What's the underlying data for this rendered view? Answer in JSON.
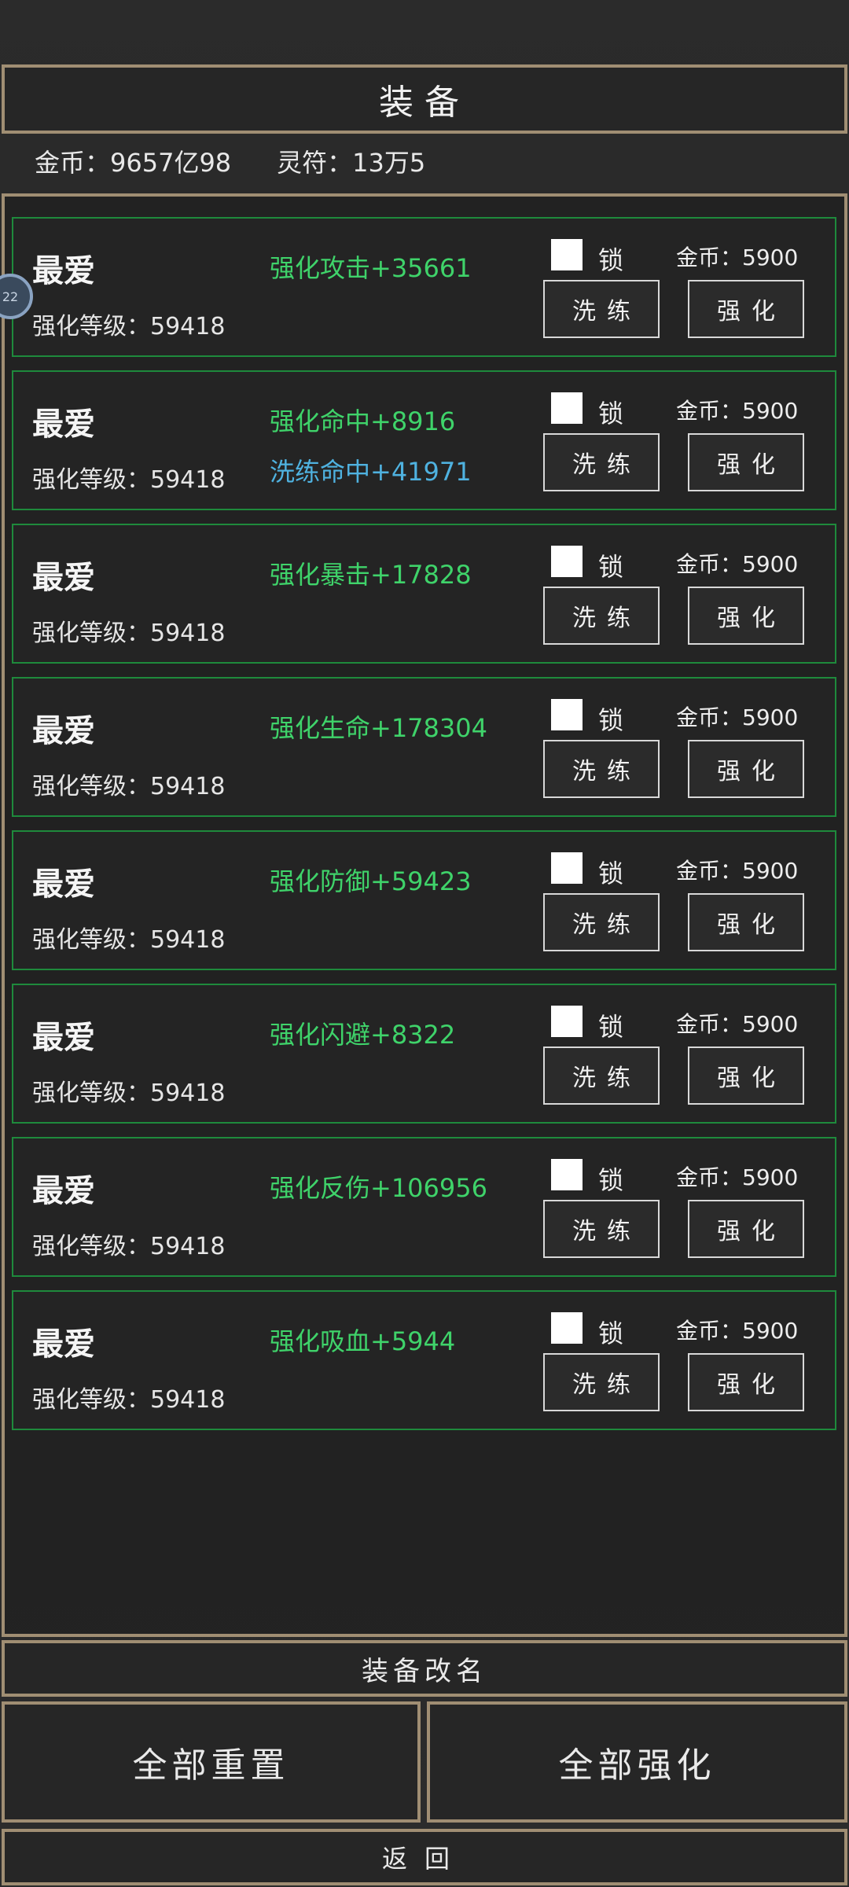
{
  "header": {
    "title": "装备"
  },
  "currency": {
    "gold": "金币：9657亿98",
    "talisman": "灵符：13万5"
  },
  "side_badge": "22",
  "card_common": {
    "name": "最爱",
    "level": "强化等级：59418",
    "lock_label": "锁",
    "cost": "金币：5900",
    "refine_label": "洗练",
    "upgrade_label": "强化"
  },
  "items": [
    {
      "stat": "强化攻击+35661",
      "refine_stat": ""
    },
    {
      "stat": "强化命中+8916",
      "refine_stat": "洗练命中+41971"
    },
    {
      "stat": "强化暴击+17828",
      "refine_stat": ""
    },
    {
      "stat": "强化生命+178304",
      "refine_stat": ""
    },
    {
      "stat": "强化防御+59423",
      "refine_stat": ""
    },
    {
      "stat": "强化闪避+8322",
      "refine_stat": ""
    },
    {
      "stat": "强化反伤+106956",
      "refine_stat": ""
    },
    {
      "stat": "强化吸血+5944",
      "refine_stat": ""
    }
  ],
  "footer": {
    "rename": "装备改名",
    "reset_all": "全部重置",
    "upgrade_all": "全部强化",
    "back": "返回"
  },
  "colors": {
    "frame": "#a08e73",
    "card_border": "#1e8a3c",
    "stat_green": "#3fd36a",
    "stat_blue": "#4fb2e0"
  }
}
